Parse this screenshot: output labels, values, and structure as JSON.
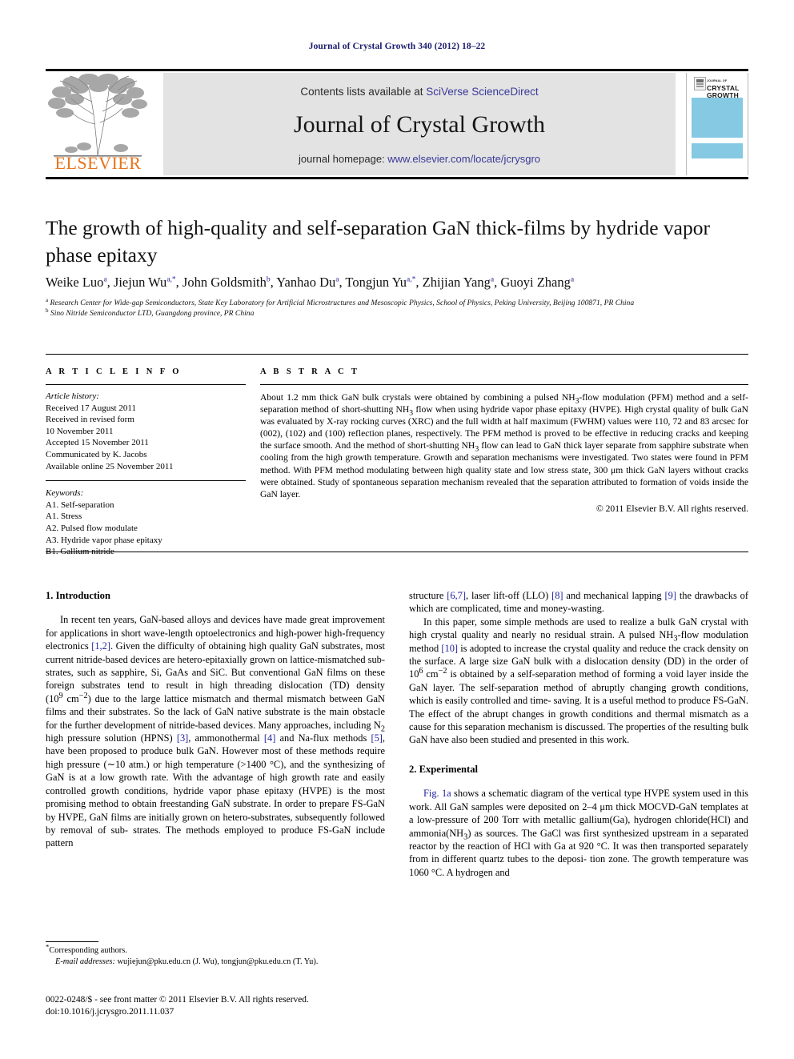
{
  "running_head": "Journal of Crystal Growth 340 (2012) 18–22",
  "masthead": {
    "contents_prefix": "Contents lists available at ",
    "contents_link": "SciVerse ScienceDirect",
    "journal_name": "Journal of Crystal Growth",
    "homepage_prefix": "journal homepage: ",
    "homepage_link": "www.elsevier.com/locate/jcrysgro",
    "publisher": "ELSEVIER",
    "cover_title_small": "JOURNAL OF",
    "cover_title_line1": "CRYSTAL",
    "cover_title_line2": "GROWTH",
    "cover_accent_color": "#85c9e3",
    "link_color": "#3a3a99",
    "elsevier_orange": "#E8731A"
  },
  "article": {
    "title": "The growth of high-quality and self-separation GaN thick-films by hydride vapor phase epitaxy",
    "authors": "Weike Luo a, Jiejun Wu a,*, John Goldsmith b, Yanhao Du a, Tongjun Yu a,*, Zhijian Yang a, Guoyi Zhang a",
    "affiliation_a": "Research Center for Wide-gap Semiconductors, State Key Laboratory for Artificial Microstructures and Mesoscopic Physics, School of Physics, Peking University, Beijing 100871, PR China",
    "affiliation_b": "Sino Nitride Semiconductor LTD, Guangdong province, PR China"
  },
  "info": {
    "label": "A R T I C L E   I N F O",
    "history_title": "Article history:",
    "history_lines": [
      "Received 17 August 2011",
      "Received in revised form",
      "10 November 2011",
      "Accepted 15 November 2011",
      "Communicated by K. Jacobs",
      "Available online 25 November 2011"
    ],
    "keywords_title": "Keywords:",
    "keywords": [
      "A1. Self-separation",
      "A1. Stress",
      "A2. Pulsed flow modulate",
      "A3. Hydride vapor phase epitaxy",
      "B1. Gallium nitride"
    ]
  },
  "abstract": {
    "label": "A B S T R A C T",
    "text": "About 1.2 mm thick GaN bulk crystals were obtained by combining a pulsed NH3-flow modulation (PFM) method and a self-separation method of short-shutting NH3 flow when using hydride vapor phase epitaxy (HVPE). High crystal quality of bulk GaN was evaluated by X-ray rocking curves (XRC) and the full width at half maximum (FWHM) values were 110, 72 and 83 arcsec for (002), (102) and (100) reflection planes, respectively. The PFM method is proved to be effective in reducing cracks and keeping the surface smooth. And the method of short-shutting NH3 flow can lead to GaN thick layer separate from sapphire substrate when cooling from the high growth temperature. Growth and separation mechanisms were investigated. Two states were found in PFM method. With PFM method modulating between high quality state and low stress state, 300 μm thick GaN layers without cracks were obtained. Study of spontaneous separation mechanism revealed that the separation attributed to formation of voids inside the GaN layer.",
    "copyright": "© 2011 Elsevier B.V. All rights reserved."
  },
  "sections": {
    "introduction_heading": "1.  Introduction",
    "intro_p1": "In recent ten years, GaN-based alloys and devices have made great improvement for applications in short wave-length optoelectronics and high-power high-frequency electronics [1,2]. Given the difficulty of obtaining high quality GaN substrates, most current nitride-based devices are hetero-epitaxially grown on lattice-mismatched substrates, such as sapphire, Si, GaAs and SiC. But conventional GaN films on these foreign substrates tend to result in high threading dislocation (TD) density (10^9 cm−2) due to the large lattice mismatch and thermal mismatch between GaN films and their substrates. So the lack of GaN native substrate is the main obstacle for the further development of nitride-based devices. Many approaches, including N2 high pressure solution (HPNS) [3], ammonothermal [4] and Na-flux methods [5], have been proposed to produce bulk GaN. However most of these methods require high pressure (~10 atm.) or high temperature (>1400 °C), and the synthesizing of GaN is at a low growth rate. With the advantage of high growth rate and easily controlled growth conditions, hydride vapor phase epitaxy (HVPE) is the most promising method to obtain freestanding GaN substrate. In order to prepare FS-GaN by HVPE, GaN films are initially grown on hetero-substrates, subsequently followed by removal of substrates. The methods employed to produce FS-GaN include pattern structure [6,7], laser lift-off (LLO) [8] and mechanical lapping [9] the drawbacks of which are complicated, time and money-wasting.",
    "intro_p2": "In this paper, some simple methods are used to realize a bulk GaN crystal with high crystal quality and nearly no residual strain. A pulsed NH3-flow modulation method [10] is adopted to increase the crystal quality and reduce the crack density on the surface. A large size GaN bulk with a dislocation density (DD) in the order of 10^6 cm−2 is obtained by a self-separation method of forming a void layer inside the GaN layer. The self-separation method of abruptly changing growth conditions, which is easily controlled and time-saving. It is a useful method to produce FS-GaN. The effect of the abrupt changes in growth conditions and thermal mismatch as a cause for this separation mechanism is discussed. The properties of the resulting bulk GaN have also been studied and presented in this work.",
    "experimental_heading": "2.  Experimental",
    "exp_p1": "Fig. 1a shows a schematic diagram of the vertical type HVPE system used in this work. All GaN samples were deposited on 2–4 μm thick MOCVD-GaN templates at a low-pressure of 200 Torr with metallic gallium(Ga), hydrogen chloride(HCl) and ammonia(NH3) as sources. The GaCl was first synthesized upstream in a separated reactor by the reaction of HCl with Ga at 920 °C. It was then transported separately from in different quartz tubes to the deposition zone. The growth temperature was 1060 °C. A hydrogen and"
  },
  "footnote": {
    "marker": "*",
    "corresponding": "Corresponding authors.",
    "email_label": "E-mail addresses:",
    "emails": "wujiejun@pku.edu.cn (J. Wu), tongjun@pku.edu.cn (T. Yu)."
  },
  "footer": {
    "issn_line": "0022-0248/$ - see front matter © 2011 Elsevier B.V. All rights reserved.",
    "doi_line": "doi:10.1016/j.jcrysgro.2011.11.037"
  }
}
